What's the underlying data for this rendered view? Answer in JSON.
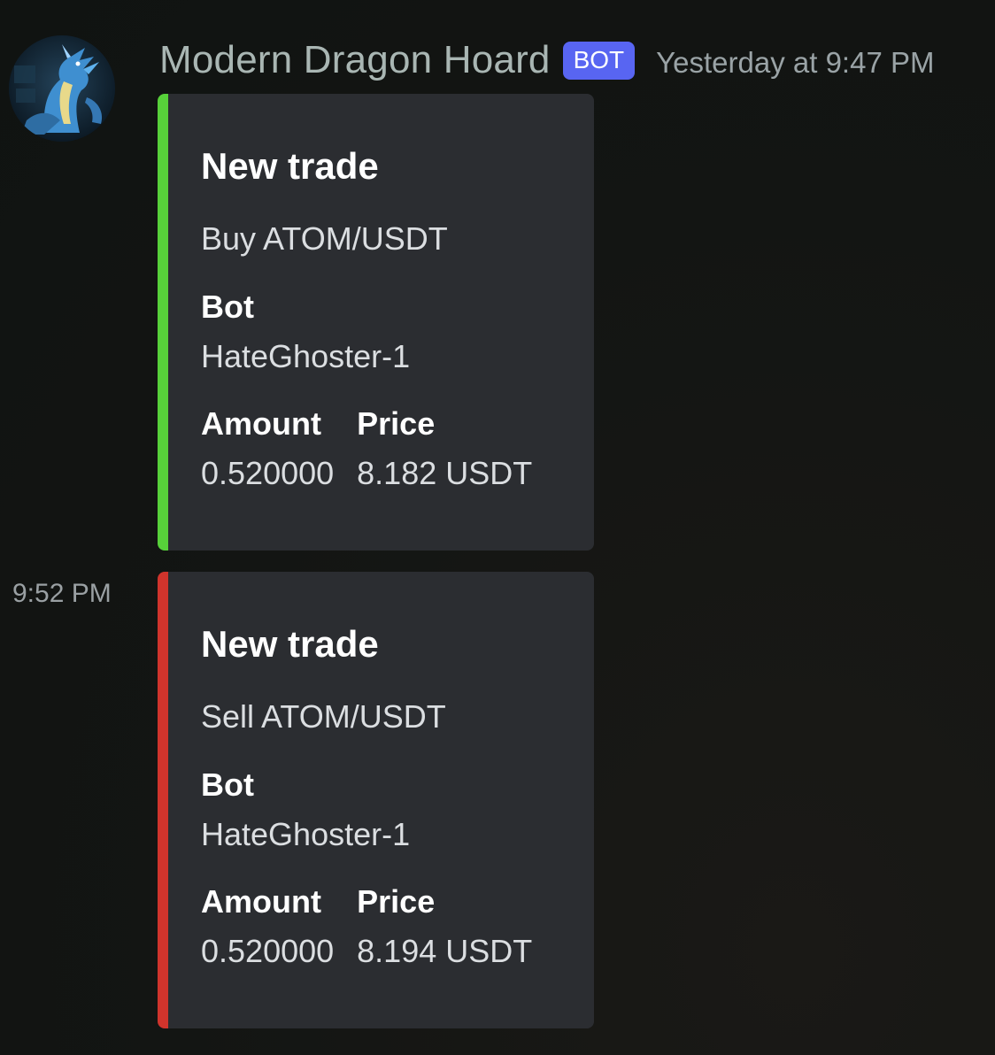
{
  "colors": {
    "buy_accent": "#57d13a",
    "sell_accent": "#d0342c",
    "bot_tag": "#5865f2",
    "embed_bg": "#2b2d31"
  },
  "message": {
    "avatar_icon": "dragon-avatar-icon",
    "author": "Modern Dragon Hoard",
    "bot_tag": "BOT",
    "timestamp": "Yesterday at 9:47 PM",
    "followup_time": "9:52 PM"
  },
  "embeds": [
    {
      "accent": "#57d13a",
      "title": "New trade",
      "description": "Buy ATOM/USDT",
      "bot_label": "Bot",
      "bot_value": "HateGhoster-1",
      "amount_label": "Amount",
      "amount_value": "0.520000",
      "price_label": "Price",
      "price_value": "8.182 USDT"
    },
    {
      "accent": "#d0342c",
      "title": "New trade",
      "description": "Sell ATOM/USDT",
      "bot_label": "Bot",
      "bot_value": "HateGhoster-1",
      "amount_label": "Amount",
      "amount_value": "0.520000",
      "price_label": "Price",
      "price_value": "8.194 USDT"
    }
  ]
}
